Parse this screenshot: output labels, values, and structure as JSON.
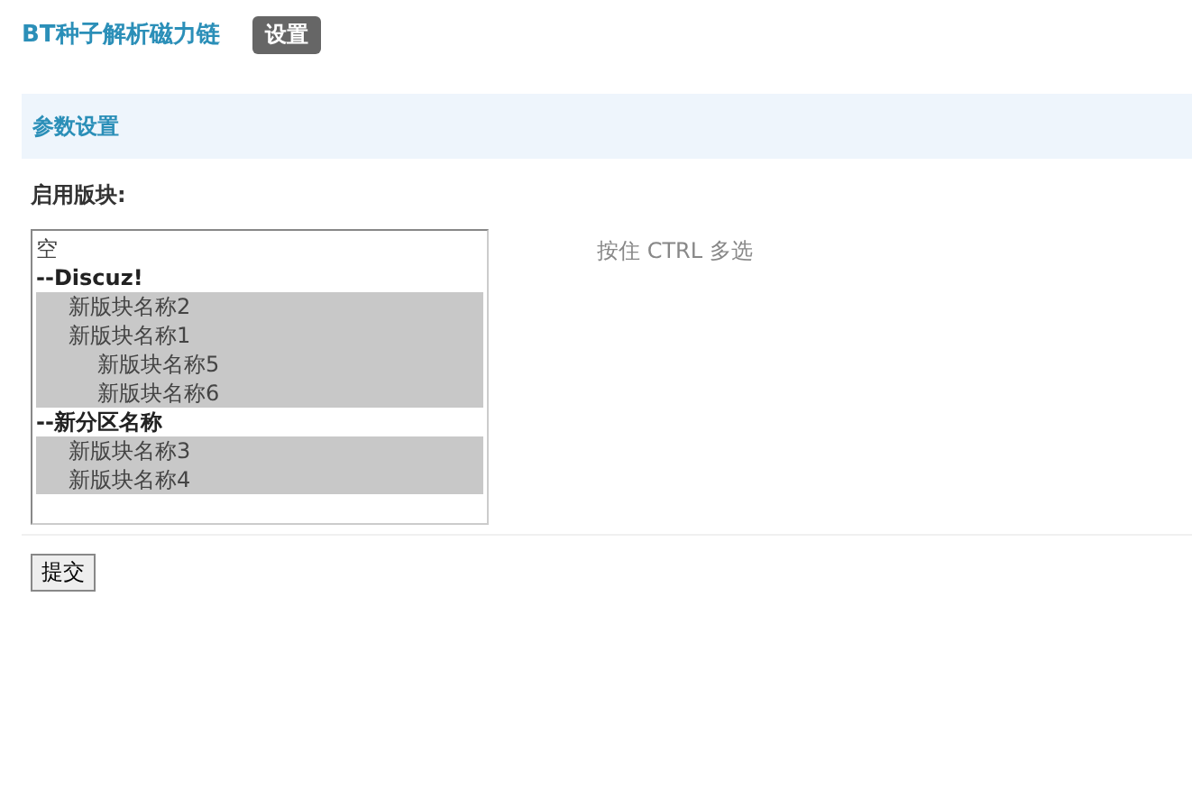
{
  "header": {
    "title": "BT种子解析磁力链",
    "tab": {
      "label": "设置",
      "selected": true
    }
  },
  "section": {
    "title": "参数设置"
  },
  "field": {
    "label": "启用版块:",
    "hint": "按住 CTRL 多选",
    "options": [
      {
        "kind": "option",
        "label": "空",
        "selected": false
      },
      {
        "kind": "group",
        "label": "--Discuz!",
        "selected": false,
        "children": [
          {
            "kind": "option",
            "label": "新版块名称2",
            "selected": true
          },
          {
            "kind": "option",
            "label": "新版块名称1",
            "selected": true,
            "children": [
              {
                "kind": "option",
                "label": "新版块名称5",
                "selected": true
              },
              {
                "kind": "option",
                "label": "新版块名称6",
                "selected": true
              }
            ]
          }
        ]
      },
      {
        "kind": "group",
        "label": "--新分区名称",
        "selected": false,
        "children": [
          {
            "kind": "option",
            "label": "新版块名称3",
            "selected": true
          },
          {
            "kind": "option",
            "label": "新版块名称4",
            "selected": true
          }
        ]
      }
    ]
  },
  "submit": {
    "label": "提交"
  }
}
